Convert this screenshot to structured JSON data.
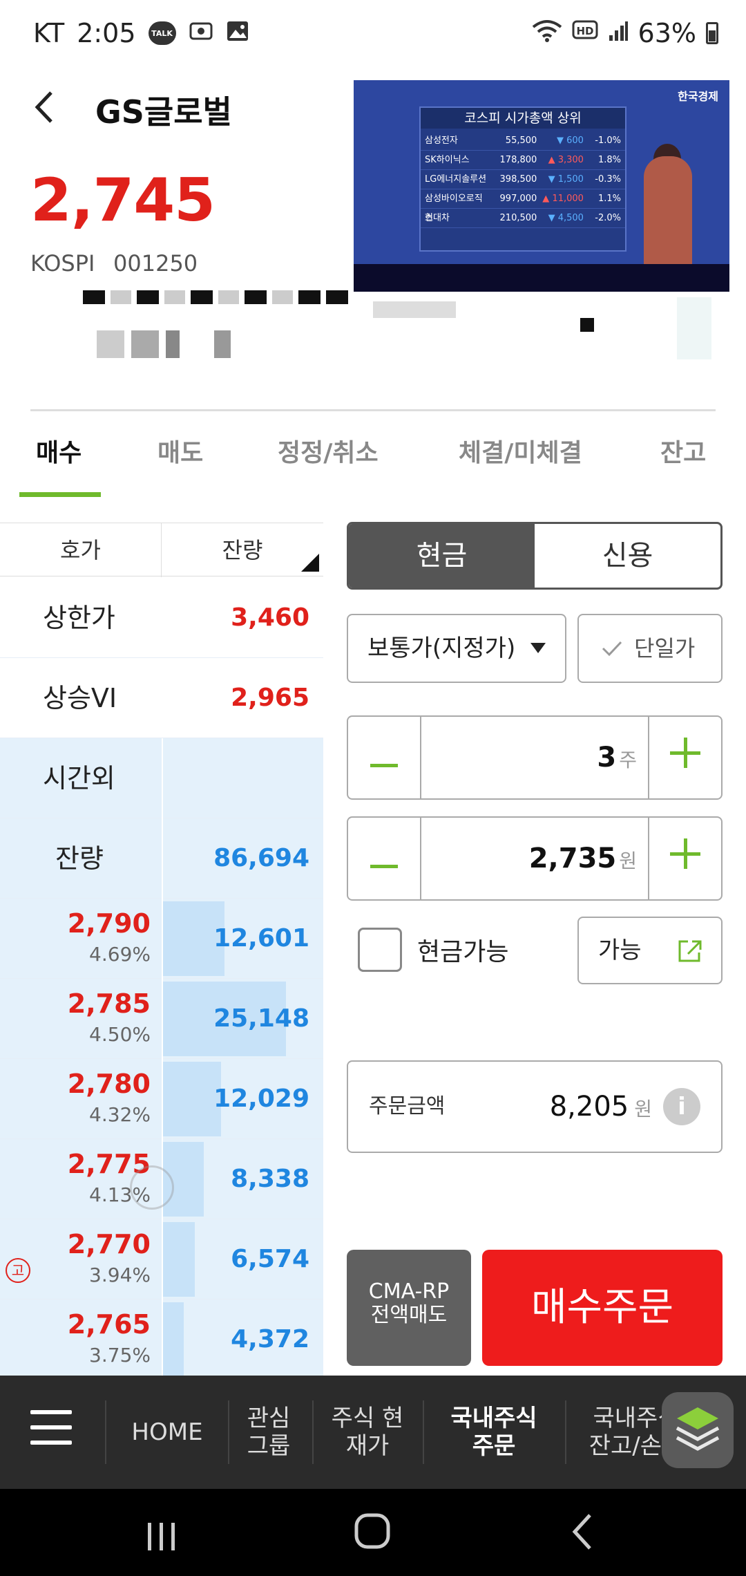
{
  "status_bar": {
    "carrier": "KT",
    "time": "2:05",
    "talk_badge": "TALK",
    "battery": "63%"
  },
  "header": {
    "title": "GS글로벌",
    "price": "2,745",
    "market": "KOSPI",
    "code": "001250"
  },
  "video": {
    "panel_title": "코스피 시가총액 상위",
    "rows": [
      {
        "name": "삼성전자",
        "price": "55,500",
        "chg": "600",
        "pct": "-1.0%"
      },
      {
        "name": "SK하이닉스",
        "price": "178,800",
        "chg": "3,300",
        "pct": "1.8%"
      },
      {
        "name": "LG에너지솔루션",
        "price": "398,500",
        "chg": "1,500",
        "pct": "-0.3%"
      },
      {
        "name": "삼성바이오로직스",
        "price": "997,000",
        "chg": "11,000",
        "pct": "1.1%"
      },
      {
        "name": "현대차",
        "price": "210,500",
        "chg": "4,500",
        "pct": "-2.0%"
      }
    ],
    "channel": "한국경제"
  },
  "tabs": [
    "매수",
    "매도",
    "정정/취소",
    "체결/미체결",
    "잔고"
  ],
  "orderbook": {
    "header": {
      "price": "호가",
      "qty": "잔량"
    },
    "upper_limit": {
      "label": "상한가",
      "value": "3,460"
    },
    "vi": {
      "label": "상승VI",
      "value": "2,965"
    },
    "after_hours": {
      "label": "시간외"
    },
    "remain": {
      "label": "잔량",
      "value": "86,694"
    },
    "asks": [
      {
        "price": "2,790",
        "pct": "4.69%",
        "qty": "12,601",
        "fill": 0.39
      },
      {
        "price": "2,785",
        "pct": "4.50%",
        "qty": "25,148",
        "fill": 0.78
      },
      {
        "price": "2,780",
        "pct": "4.32%",
        "qty": "12,029",
        "fill": 0.37
      },
      {
        "price": "2,775",
        "pct": "4.13%",
        "qty": "8,338",
        "fill": 0.26
      },
      {
        "price": "2,770",
        "pct": "3.94%",
        "qty": "6,574",
        "fill": 0.2
      },
      {
        "price": "2,765",
        "pct": "3.75%",
        "qty": "4,372",
        "fill": 0.13
      }
    ],
    "high_mark": "고"
  },
  "form": {
    "seg_cash": "현금",
    "seg_credit": "신용",
    "order_type": "보통가(지정가)",
    "single_price": "단일가",
    "qty_value": "3",
    "qty_unit": "주",
    "price_value": "2,735",
    "price_unit": "원",
    "cash_available": "현금가능",
    "available": "가능",
    "amount_label": "주문금액",
    "amount_value": "8,205",
    "amount_unit": "원",
    "cma_label": "CMA-RP 전액매도",
    "buy_label": "매수주문"
  },
  "bottom_nav": [
    {
      "label": "HOME"
    },
    {
      "label": "관심 그룹"
    },
    {
      "label": "주식 현재가"
    },
    {
      "label": "국내주식 주문"
    },
    {
      "label": "국내주식 잔고/손익"
    }
  ],
  "colors": {
    "up": "#e0211b",
    "down": "#1f86e0",
    "accent": "#6fba2c"
  }
}
